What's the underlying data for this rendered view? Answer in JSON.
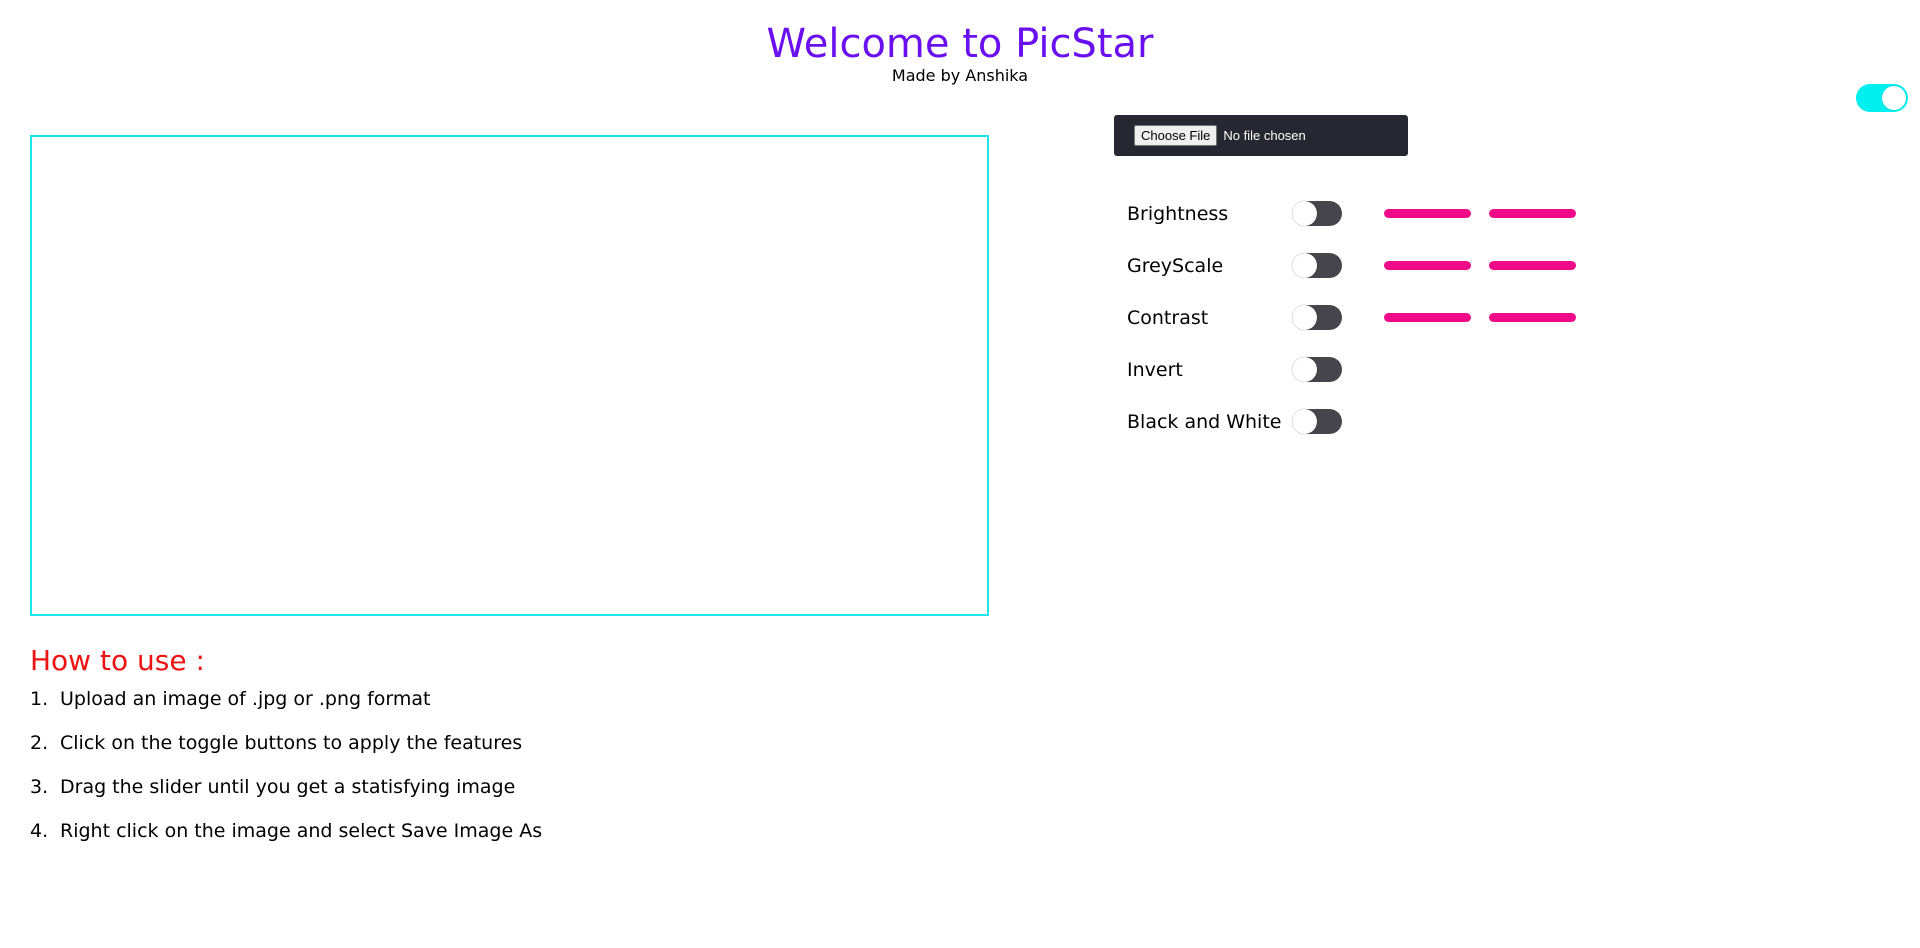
{
  "header": {
    "title": "Welcome to PicStar",
    "subtitle": "Made by Anshika",
    "title_color": "#6a0ff0"
  },
  "theme_toggle": {
    "state": "on",
    "color": "#00f0f0"
  },
  "upload": {
    "button_label": "Choose File",
    "status": "No file chosen"
  },
  "controls": [
    {
      "label": "Brightness",
      "toggle": "off",
      "has_slider": true,
      "slider_value": 0.5
    },
    {
      "label": "GreyScale",
      "toggle": "off",
      "has_slider": true,
      "slider_value": 0.5
    },
    {
      "label": "Contrast",
      "toggle": "off",
      "has_slider": true,
      "slider_value": 0.5
    },
    {
      "label": "Invert",
      "toggle": "off",
      "has_slider": false
    },
    {
      "label": "Black and White",
      "toggle": "off",
      "has_slider": false
    }
  ],
  "colors": {
    "canvas_border": "#1ee6e6",
    "slider": "#f00a8a",
    "howto_title": "#ee1111",
    "upload_bar": "#272731"
  },
  "howto": {
    "title": "How to use :",
    "steps": [
      {
        "num": "1.",
        "text": "Upload an image of .jpg or .png format"
      },
      {
        "num": "2.",
        "text": "Click on the toggle buttons to apply the features"
      },
      {
        "num": "3.",
        "text": "Drag the slider until you get a statisfying image"
      },
      {
        "num": "4.",
        "text": "Right click on the image and select Save Image As"
      }
    ]
  }
}
